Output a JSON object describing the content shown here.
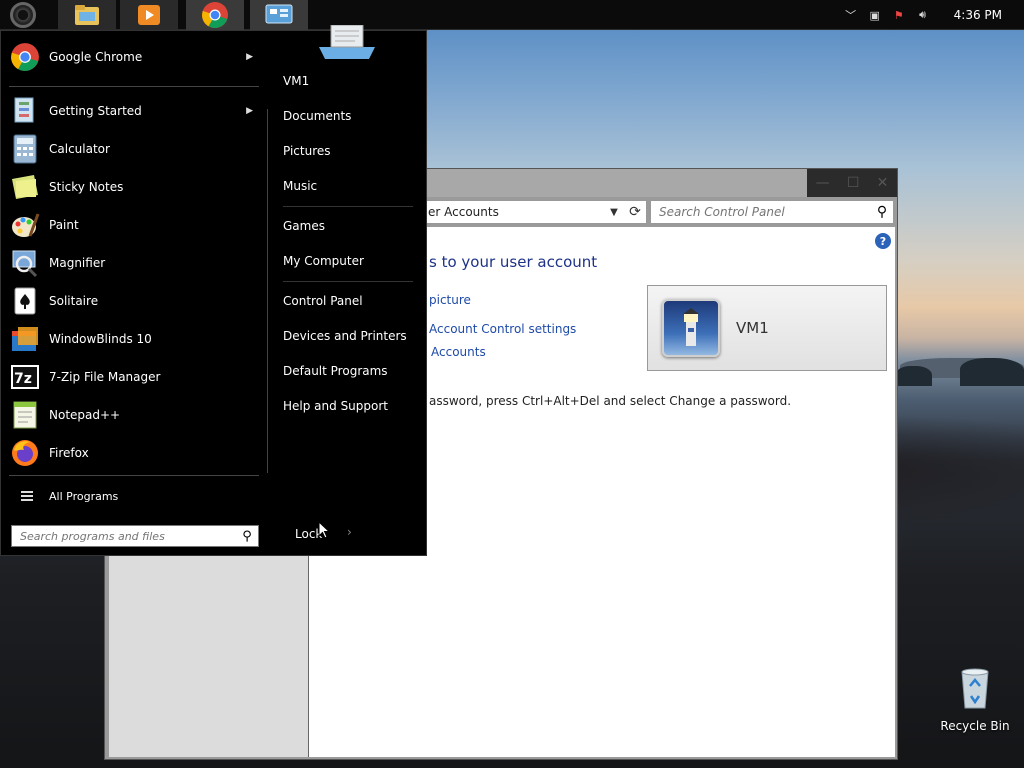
{
  "taskbar": {
    "clock": "4:36 PM",
    "apps": [
      {
        "name": "file-explorer-icon"
      },
      {
        "name": "media-player-icon"
      },
      {
        "name": "chrome-icon"
      },
      {
        "name": "control-panel-icon"
      }
    ]
  },
  "control_panel": {
    "address": "er Accounts",
    "search_placeholder": "Search Control Panel",
    "heading": "s to your user account",
    "links": [
      "picture",
      "Account Control settings",
      "Accounts"
    ],
    "note": "assword, press Ctrl+Alt+Del and select Change a password.",
    "user_name": "VM1",
    "help": "?"
  },
  "start_menu": {
    "programs": [
      {
        "label": "Google Chrome",
        "icon": "chrome-icon",
        "submenu": true
      },
      {
        "label": "Getting Started",
        "icon": "getting-started-icon",
        "submenu": true
      },
      {
        "label": "Calculator",
        "icon": "calculator-icon",
        "submenu": false
      },
      {
        "label": "Sticky Notes",
        "icon": "sticky-notes-icon",
        "submenu": false
      },
      {
        "label": "Paint",
        "icon": "paint-icon",
        "submenu": false
      },
      {
        "label": "Magnifier",
        "icon": "magnifier-icon",
        "submenu": false
      },
      {
        "label": "Solitaire",
        "icon": "solitaire-icon",
        "submenu": false
      },
      {
        "label": "WindowBlinds 10",
        "icon": "windowblinds-icon",
        "submenu": false
      },
      {
        "label": "7-Zip File Manager",
        "icon": "seven-zip-icon",
        "submenu": false
      },
      {
        "label": "Notepad++",
        "icon": "notepad-plus-plus-icon",
        "submenu": false
      },
      {
        "label": "Firefox",
        "icon": "firefox-icon",
        "submenu": false
      }
    ],
    "all_programs": "All Programs",
    "search_placeholder": "Search programs and files",
    "right": [
      "VM1",
      "Documents",
      "Pictures",
      "Music",
      "Games",
      "My Computer",
      "Control Panel",
      "Devices and Printers",
      "Default Programs",
      "Help and Support"
    ],
    "lock": "Lock"
  },
  "desktop": {
    "recycle_bin": "Recycle Bin"
  }
}
